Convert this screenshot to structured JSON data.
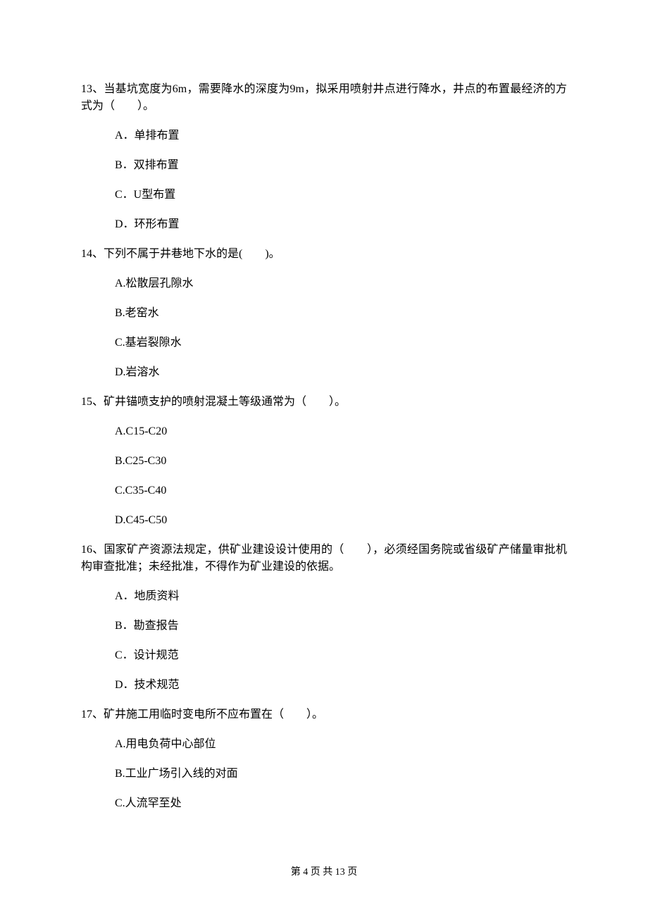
{
  "questions": [
    {
      "stem": "13、当基坑宽度为6m，需要降水的深度为9m，拟采用喷射井点进行降水，井点的布置最经济的方式为（　　）。",
      "options": [
        "A．单排布置",
        "B．双排布置",
        "C．U型布置",
        "D．环形布置"
      ]
    },
    {
      "stem": "14、下列不属于井巷地下水的是(　　)。",
      "options": [
        "A.松散层孔隙水",
        "B.老窑水",
        "C.基岩裂隙水",
        "D.岩溶水"
      ]
    },
    {
      "stem": "15、矿井锚喷支护的喷射混凝土等级通常为（　　）。",
      "options": [
        "A.C15-C20",
        "B.C25-C30",
        "C.C35-C40",
        "D.C45-C50"
      ]
    },
    {
      "stem": "16、国家矿产资源法规定，供矿业建设设计使用的（　　），必须经国务院或省级矿产储量审批机构审查批准；未经批准，不得作为矿业建设的依据。",
      "options": [
        "A．地质资料",
        "B．勘查报告",
        "C．设计规范",
        "D．技术规范"
      ]
    },
    {
      "stem": "17、矿井施工用临时变电所不应布置在（　　）。",
      "options": [
        "A.用电负荷中心部位",
        "B.工业广场引入线的对面",
        "C.人流罕至处"
      ]
    }
  ],
  "footer": "第 4 页 共 13 页"
}
